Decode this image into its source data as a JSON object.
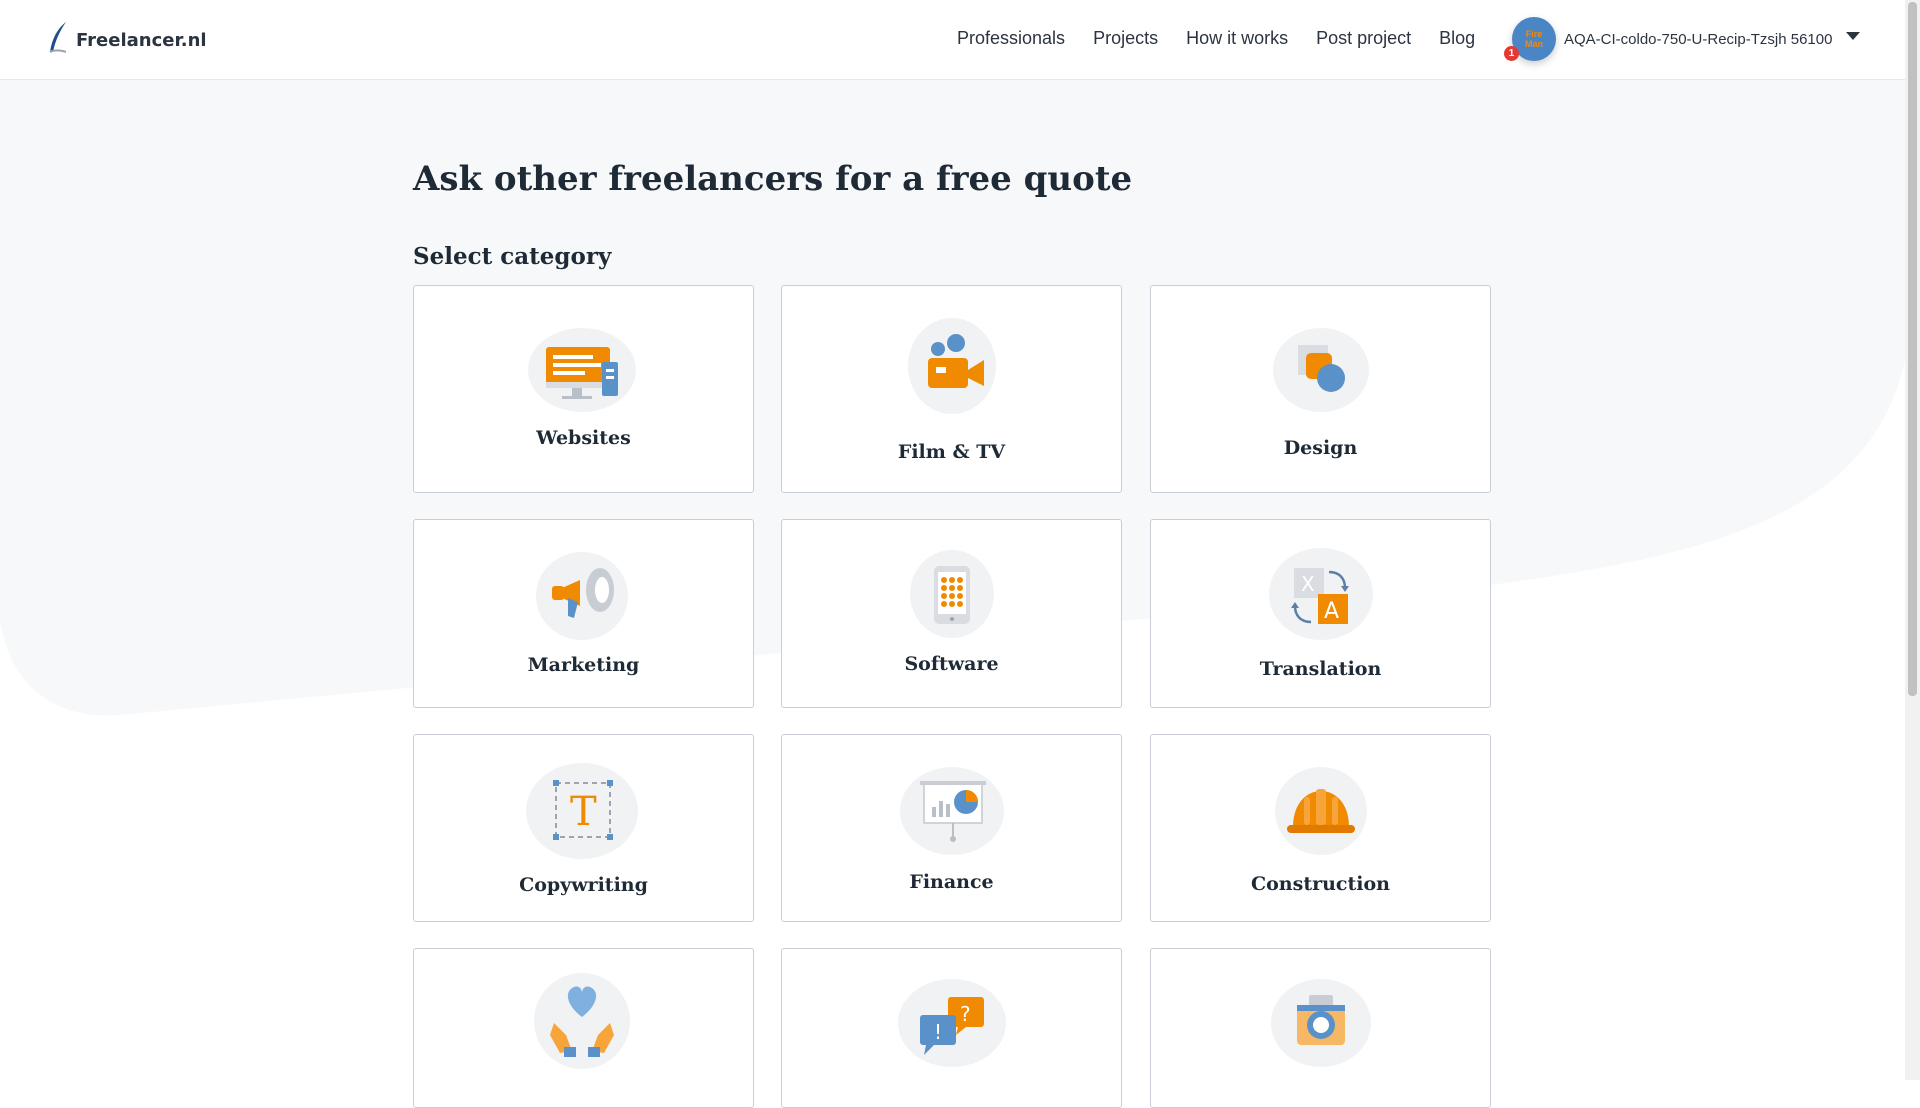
{
  "header": {
    "logo_text": "Freelancer.nl",
    "nav": [
      "Professionals",
      "Projects",
      "How it works",
      "Post project",
      "Blog"
    ],
    "user": {
      "avatar_text": "Fire Man",
      "notification_count": "1",
      "name": "AQA-CI-coldo-750-U-Recip-Tzsjh 56100"
    }
  },
  "main": {
    "title": "Ask other freelancers for a free quote",
    "subtitle": "Select category",
    "categories": [
      {
        "label": "Websites",
        "icon": "monitor-icon"
      },
      {
        "label": "Film & TV",
        "icon": "video-camera-icon"
      },
      {
        "label": "Design",
        "icon": "shapes-icon"
      },
      {
        "label": "Marketing",
        "icon": "megaphone-icon"
      },
      {
        "label": "Software",
        "icon": "phone-app-icon"
      },
      {
        "label": "Translation",
        "icon": "translate-icon"
      },
      {
        "label": "Copywriting",
        "icon": "text-tool-icon"
      },
      {
        "label": "Finance",
        "icon": "presentation-chart-icon"
      },
      {
        "label": "Construction",
        "icon": "hard-hat-icon"
      },
      {
        "label": "",
        "icon": "heart-hands-icon"
      },
      {
        "label": "",
        "icon": "speech-bubbles-icon"
      },
      {
        "label": "",
        "icon": "camera-icon"
      }
    ]
  },
  "colors": {
    "accent_orange": "#f08a00",
    "accent_blue": "#5b91c9",
    "avatar_blue": "#4a86c5",
    "notification_red": "#e53935"
  }
}
